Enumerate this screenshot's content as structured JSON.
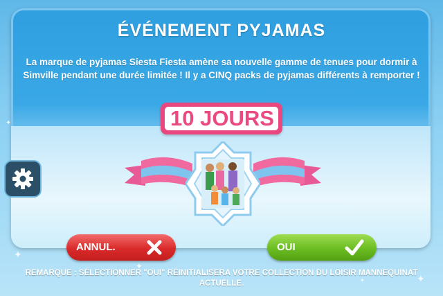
{
  "dialog": {
    "title": "ÉVÉNEMENT PYJAMAS",
    "description": "La marque de pyjamas Siesta Fiesta amène sa nouvelle gamme de tenues pour dormir à Simville pendant une durée limitée ! Il y a CINQ packs de pyjamas différents à remporter !",
    "duration_badge": "10 JOURS",
    "cancel_label": "ANNUL.",
    "confirm_label": "OUI",
    "note": "REMARQUE : SÉLECTIONNER \"OUI\" RÉINITIALISERA VOTRE COLLECTION DU LOISIR MANNEQUINAT ACTUELLE."
  },
  "icons": {
    "settings": "gear-icon",
    "cancel": "cross-icon",
    "confirm": "checkmark-icon",
    "emblem": "sims-family-portrait-icon"
  },
  "colors": {
    "badge_pink": "#e8487f",
    "cancel_red": "#d92a2a",
    "confirm_green": "#6bbd22",
    "ribbon_pink": "#f06aa0",
    "ribbon_blue": "#7fc4ee"
  }
}
